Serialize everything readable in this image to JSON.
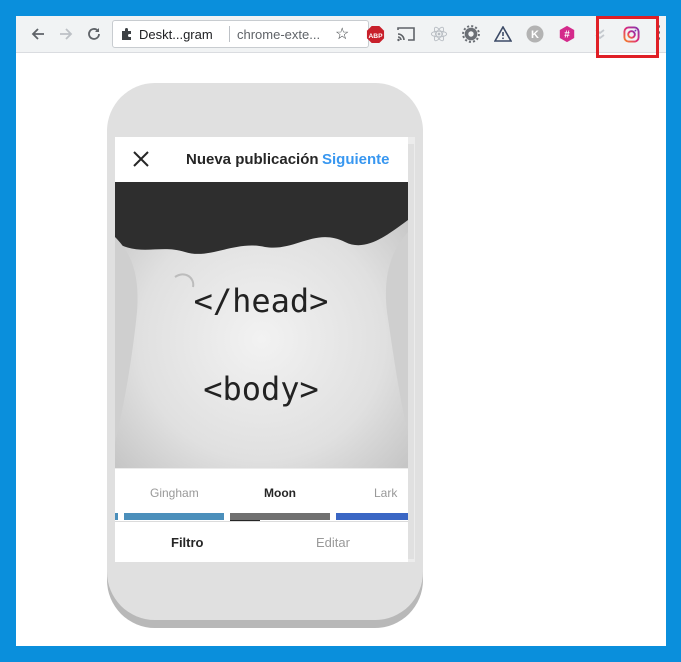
{
  "browser": {
    "omnibox": {
      "extension_name": "Deskt...gram",
      "url": "chrome-exte..."
    },
    "extensions": [
      {
        "name": "adblock-plus-icon",
        "label": "ABP",
        "color": "#c8202b"
      },
      {
        "name": "cast-icon"
      },
      {
        "name": "react-devtools-icon"
      },
      {
        "name": "settings-gear-icon"
      },
      {
        "name": "warning-icon"
      },
      {
        "name": "k-extension-icon",
        "label": "K"
      },
      {
        "name": "hashtag-extension-icon",
        "label": "#",
        "color": "#d42a8b"
      },
      {
        "name": "collapsed-extension-icon"
      },
      {
        "name": "instagram-icon"
      }
    ]
  },
  "app": {
    "header": {
      "title": "Nueva publicación",
      "next": "Siguiente"
    },
    "photo": {
      "line1": "</head>",
      "line2": "<body>"
    },
    "filters": [
      {
        "label": "Gingham",
        "active": false,
        "color": "#4b8fbb"
      },
      {
        "label": "Moon",
        "active": true,
        "color": "#707070"
      },
      {
        "label": "Lark",
        "active": false,
        "color": "#3a66c4"
      }
    ],
    "tabs": {
      "filter": "Filtro",
      "edit": "Editar"
    }
  },
  "colors": {
    "accent": "#3897f0",
    "frame_blue": "#0a8fdc",
    "highlight_red": "#e01f26"
  }
}
